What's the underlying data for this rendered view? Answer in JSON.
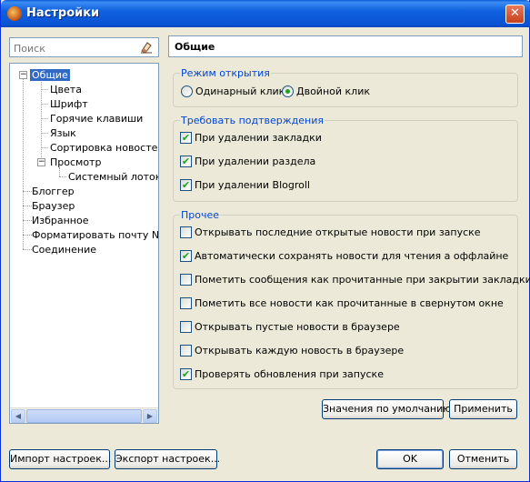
{
  "window": {
    "title": "Настройки",
    "close": "✕"
  },
  "search": {
    "placeholder": "Поиск"
  },
  "tree": {
    "general": "Общие",
    "colors": "Цвета",
    "font": "Шрифт",
    "hotkeys": "Горячие клавиши",
    "language": "Язык",
    "sort_news": "Сортировка новостей",
    "view": "Просмотр",
    "systray": "Системный лоток",
    "blogger": "Блоггер",
    "browser": "Браузер",
    "favorites": "Избранное",
    "format_mail": "Форматировать почту New",
    "connection": "Соединение",
    "expander_minus": "−"
  },
  "panel": {
    "title": "Общие",
    "open_mode": {
      "legend": "Режим открытия",
      "single": "Одинарный клик",
      "double": "Двойной клик"
    },
    "confirm": {
      "legend": "Требовать подтверждения",
      "items": [
        "При удалении закладки",
        "При удалении раздела",
        "При удалении Blogroll"
      ]
    },
    "misc": {
      "legend": "Прочее",
      "items": [
        "Открывать последние открытые новости при запуске",
        "Автоматически сохранять новости для чтения а оффлайне",
        "Пометить сообщения как прочитанные при закрытии закладки",
        "Пометить все новости как прочитанные в свернутом окне",
        "Открывать пустые новости в браузере",
        "Открывать каждую новость в браузере",
        "Проверять обновления при запуске"
      ]
    }
  },
  "check_mark": "✔",
  "buttons": {
    "defaults": "Значения по умолчанию",
    "apply": "Применить",
    "import": "Импорт настроек...",
    "export": "Экспорт настроек...",
    "ok": "OK",
    "cancel": "Отменить"
  }
}
